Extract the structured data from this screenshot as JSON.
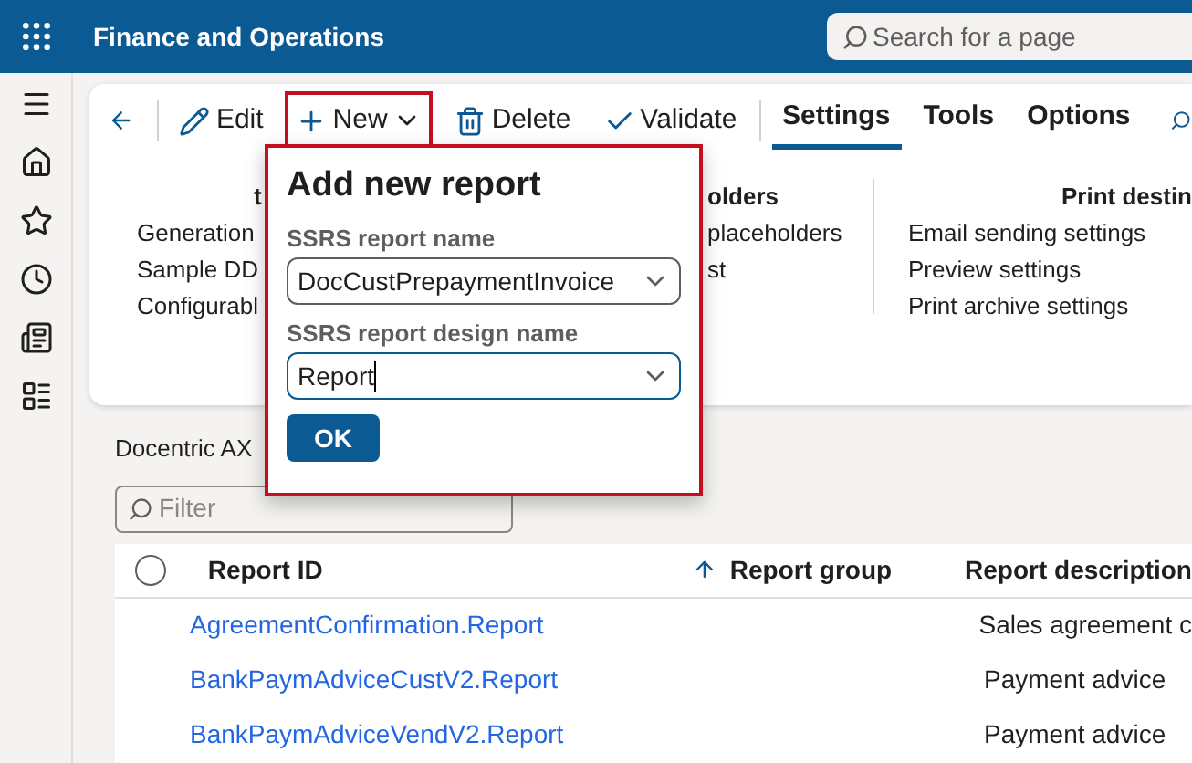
{
  "app_bar": {
    "title": "Finance and Operations",
    "search": {
      "placeholder": "Search for a page"
    }
  },
  "action_bar": {
    "buttons": [
      {
        "kind": "edit",
        "label": "Edit",
        "highlighted": false
      },
      {
        "kind": "new",
        "label": "New",
        "highlighted": true
      },
      {
        "kind": "delete",
        "label": "Delete",
        "highlighted": false
      },
      {
        "kind": "validate",
        "label": "Validate",
        "highlighted": false
      }
    ],
    "tabs": [
      {
        "label": "Settings",
        "selected": true
      },
      {
        "label": "Tools",
        "selected": false
      },
      {
        "label": "Options",
        "selected": false
      }
    ]
  },
  "ribbon_groups": [
    {
      "heading": "t",
      "items": [
        "Generation",
        "Sample DD",
        "Configurabl"
      ]
    },
    {
      "heading": "olders",
      "items": [
        "placeholders",
        "st"
      ]
    },
    {
      "heading": "Print destin",
      "items": [
        "Email sending settings",
        "Preview settings",
        "Print archive settings"
      ]
    }
  ],
  "page_title": "Docentric AX",
  "filter": {
    "placeholder": "Filter"
  },
  "grid": {
    "all_selected": false,
    "columns": [
      "Report ID",
      "Report group",
      "Report description"
    ],
    "rows": [
      [
        "AgreementConfirmation.Report",
        "",
        "Sales agreement c"
      ],
      [
        "BankPaymAdviceCustV2.Report",
        "",
        "Payment advice"
      ],
      [
        "BankPaymAdviceVendV2.Report",
        "",
        "Payment advice"
      ]
    ]
  },
  "dialog": {
    "title": "Add new report",
    "fields": [
      {
        "label": "SSRS report name",
        "value": "DocCustPrepaymentInvoice",
        "focused": false
      },
      {
        "label": "SSRS report design name",
        "value": "Report",
        "focused": true
      }
    ],
    "ok": "OK"
  }
}
